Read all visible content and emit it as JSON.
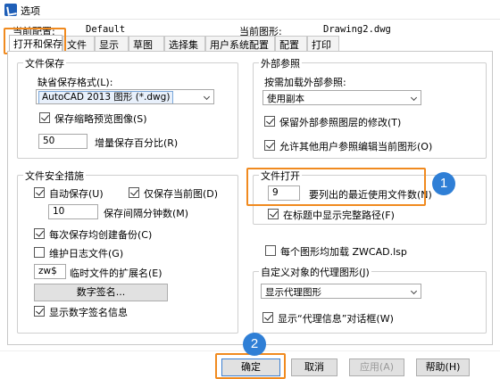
{
  "window": {
    "title": "选项"
  },
  "profile": {
    "current_profile_label": "当前配置:",
    "current_profile_value": "Default",
    "current_drawing_label": "当前图形:",
    "current_drawing_value": "Drawing2.dwg"
  },
  "tabs": [
    "打开和保存",
    "文件",
    "显示",
    "草图",
    "选择集",
    "用户系统配置",
    "配置",
    "打印"
  ],
  "file_save": {
    "title": "文件保存",
    "default_format_label": "缺省保存格式(L):",
    "default_format_value": "AutoCAD 2013 图形 (*.dwg)",
    "save_thumbnail_label": "保存缩略预览图像(S)",
    "save_thumbnail_checked": true,
    "incremental_percent_value": "50",
    "incremental_percent_label": "增量保存百分比(R)"
  },
  "file_safety": {
    "title": "文件安全措施",
    "autosave_label": "自动保存(U)",
    "autosave_checked": true,
    "save_current_only_label": "仅保存当前图(D)",
    "save_current_only_checked": true,
    "interval_value": "10",
    "interval_label": "保存间隔分钟数(M)",
    "backup_label": "每次保存均创建备份(C)",
    "backup_checked": true,
    "log_label": "维护日志文件(G)",
    "log_checked": false,
    "temp_ext_value": "zw$",
    "temp_ext_label": "临时文件的扩展名(E)",
    "digital_sig_button": "数字签名...",
    "show_sig_label": "显示数字签名信息",
    "show_sig_checked": true
  },
  "xref": {
    "title": "外部参照",
    "load_label": "按需加载外部参照:",
    "load_value": "使用副本",
    "retain_label": "保留外部参照图层的修改(T)",
    "retain_checked": true,
    "allow_edit_label": "允许其他用户参照编辑当前图形(O)",
    "allow_edit_checked": true
  },
  "file_open": {
    "title": "文件打开",
    "recent_count_value": "9",
    "recent_count_label": "要列出的最近使用文件数(N)",
    "full_path_label": "在标题中显示完整路径(F)",
    "full_path_checked": true
  },
  "per_drawing": {
    "load_lsp_label": "每个图形均加载 ZWCAD.lsp",
    "load_lsp_checked": false
  },
  "proxy": {
    "title": "自定义对象的代理图形(J)",
    "value": "显示代理图形",
    "show_info_label": "显示“代理信息”对话框(W)",
    "show_info_checked": true
  },
  "buttons": {
    "ok": "确定",
    "cancel": "取消",
    "apply": "应用(A)",
    "help": "帮助(H)"
  },
  "callouts": {
    "one": "1",
    "two": "2"
  },
  "colors": {
    "highlight": "#f08a1f",
    "badge": "#2f7fd6"
  }
}
